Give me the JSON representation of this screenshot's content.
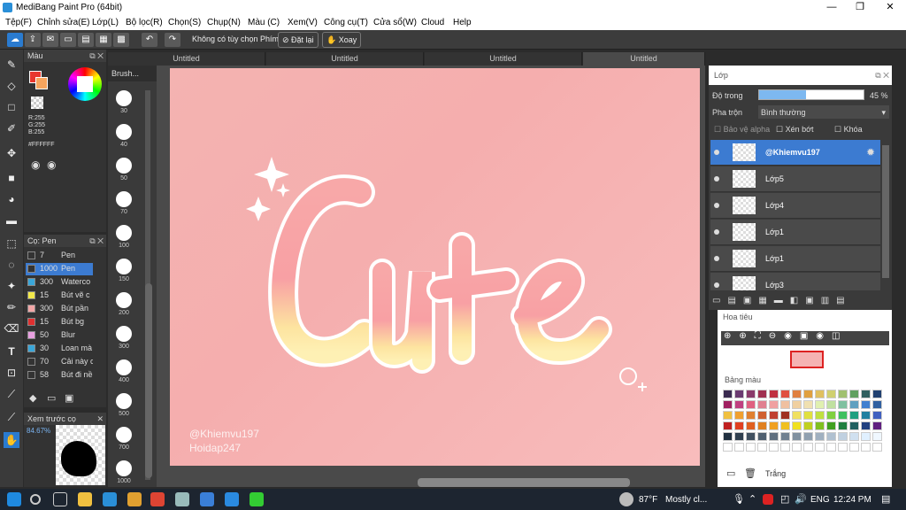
{
  "titlebar": {
    "title": "MediBang Paint Pro (64bit)",
    "min": "—",
    "max": "❐",
    "close": "✕"
  },
  "menu": [
    "Tệp(F)",
    "Chỉnh sửa(E)",
    "Lớp(L)",
    "Bộ lọc(R)",
    "Chọn(S)",
    "Chụp(N)",
    "Màu (C)",
    "Xem(V)",
    "Công cụ(T)",
    "Cửa sổ(W)",
    "Cloud",
    "Help"
  ],
  "toolbar": {
    "no_option": "Không có tùy chọn",
    "phim": "Phím",
    "reset": "Đặt lại",
    "pan": "Xoay"
  },
  "color": {
    "title": "Màu",
    "rgb_r": "R:255",
    "rgb_g": "G:255",
    "rgb_b": "B:255",
    "hex": "#FFFFFF"
  },
  "brush": {
    "title": "Cọ: Pen",
    "items": [
      {
        "size": "7",
        "name": "Pen",
        "color": "#333333"
      },
      {
        "size": "1000",
        "name": "Pen",
        "color": "#333333"
      },
      {
        "size": "300",
        "name": "Waterco",
        "color": "#3aa6d8"
      },
      {
        "size": "15",
        "name": "Bút vẽ c",
        "color": "#f3e94a"
      },
      {
        "size": "300",
        "name": "Bút pần",
        "color": "#f2a6a6"
      },
      {
        "size": "15",
        "name": "Bút bg",
        "color": "#e03030"
      },
      {
        "size": "50",
        "name": "Blur",
        "color": "#e8a0e0"
      },
      {
        "size": "30",
        "name": "Loan mà",
        "color": "#3aa6d8"
      },
      {
        "size": "70",
        "name": "Cải này c",
        "color": "#333333"
      },
      {
        "size": "58",
        "name": "Bút đi nề",
        "color": "#333333"
      }
    ]
  },
  "preview": {
    "title": "Xem trước cọ",
    "zoom": "84.67%"
  },
  "brushsizes": {
    "title": "Brush...",
    "sizes": [
      "30",
      "40",
      "50",
      "70",
      "100",
      "150",
      "200",
      "300",
      "400",
      "500",
      "700",
      "1000"
    ]
  },
  "tabs": [
    "Untitled",
    "Untitled",
    "Untitled",
    "Untitled"
  ],
  "canvas": {
    "word": "Cute",
    "watermark1": "@Khiemvu197",
    "watermark2": "Hoidap247"
  },
  "layers": {
    "title": "Lớp",
    "opacity_label": "Độ trong",
    "opacity": "45 %",
    "blend_label": "Pha trộn",
    "blend": "Bình thường",
    "protect_alpha": "Bảo vệ alpha",
    "clip": "Xén bớt",
    "lock": "Khóa",
    "items": [
      "@Khiemvu197",
      "Lớp5",
      "Lớp4",
      "Lớp1",
      "Lớp1",
      "Lớp3"
    ]
  },
  "navigator": {
    "title": "Hoa tiêu"
  },
  "palette": {
    "title": "Bảng màu",
    "footer": "Trắng"
  },
  "taskbar": {
    "weather": "87°F",
    "condition": "Mostly cl...",
    "lang": "ENG",
    "time": "12:24 PM"
  }
}
